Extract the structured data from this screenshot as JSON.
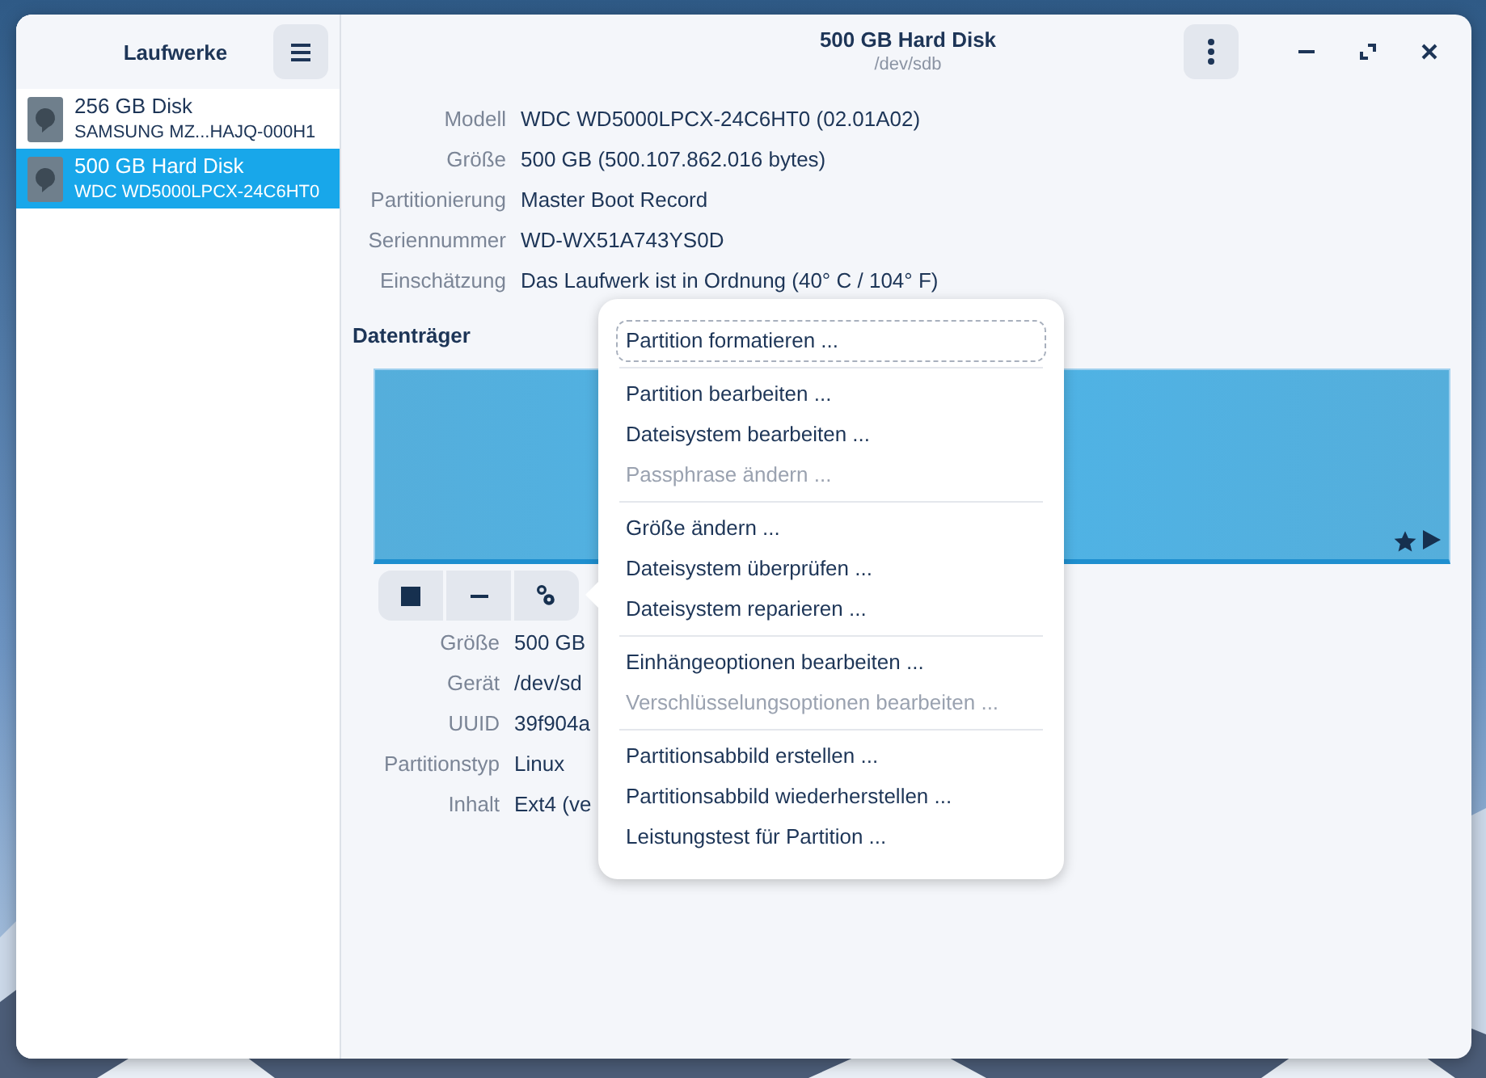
{
  "sidebar": {
    "title": "Laufwerke",
    "drives": [
      {
        "name": "256 GB Disk",
        "model": "SAMSUNG MZ...HAJQ-000H1",
        "selected": false
      },
      {
        "name": "500 GB Hard Disk",
        "model": "WDC WD5000LPCX-24C6HT0",
        "selected": true
      }
    ]
  },
  "header": {
    "title": "500 GB Hard Disk",
    "subtitle": "/dev/sdb"
  },
  "drive_info": [
    {
      "label": "Modell",
      "value": "WDC WD5000LPCX-24C6HT0 (02.01A02)"
    },
    {
      "label": "Größe",
      "value": "500 GB (500.107.862.016 bytes)"
    },
    {
      "label": "Partitionierung",
      "value": "Master Boot Record"
    },
    {
      "label": "Seriennummer",
      "value": "WD-WX51A743YS0D"
    },
    {
      "label": "Einschätzung",
      "value": "Das Laufwerk ist in Ordnung (40° C / 104° F)"
    }
  ],
  "volumes": {
    "title": "Datenträger"
  },
  "partition_info": [
    {
      "label": "Größe",
      "value": "500 GB"
    },
    {
      "label": "Gerät",
      "value": "/dev/sd"
    },
    {
      "label": "UUID",
      "value": "39f904a"
    },
    {
      "label": "Partitionstyp",
      "value": "Linux"
    },
    {
      "label": "Inhalt",
      "value": "Ext4 (ve"
    }
  ],
  "menu": {
    "sections": [
      {
        "items": [
          {
            "label": "Partition formatieren ...",
            "disabled": false,
            "focused": true
          }
        ]
      },
      {
        "items": [
          {
            "label": "Partition bearbeiten ...",
            "disabled": false,
            "focused": false
          },
          {
            "label": "Dateisystem bearbeiten ...",
            "disabled": false,
            "focused": false
          },
          {
            "label": "Passphrase ändern ...",
            "disabled": true,
            "focused": false
          }
        ]
      },
      {
        "items": [
          {
            "label": "Größe ändern ...",
            "disabled": false,
            "focused": false
          },
          {
            "label": "Dateisystem überprüfen ...",
            "disabled": false,
            "focused": false
          },
          {
            "label": "Dateisystem reparieren ...",
            "disabled": false,
            "focused": false
          }
        ]
      },
      {
        "items": [
          {
            "label": "Einhängeoptionen bearbeiten ...",
            "disabled": false,
            "focused": false
          },
          {
            "label": "Verschlüsselungsoptionen bearbeiten ...",
            "disabled": true,
            "focused": false
          }
        ]
      },
      {
        "items": [
          {
            "label": "Partitionsabbild erstellen ...",
            "disabled": false,
            "focused": false
          },
          {
            "label": "Partitionsabbild wiederherstellen ...",
            "disabled": false,
            "focused": false
          },
          {
            "label": "Leistungstest für Partition ...",
            "disabled": false,
            "focused": false
          }
        ]
      }
    ]
  }
}
